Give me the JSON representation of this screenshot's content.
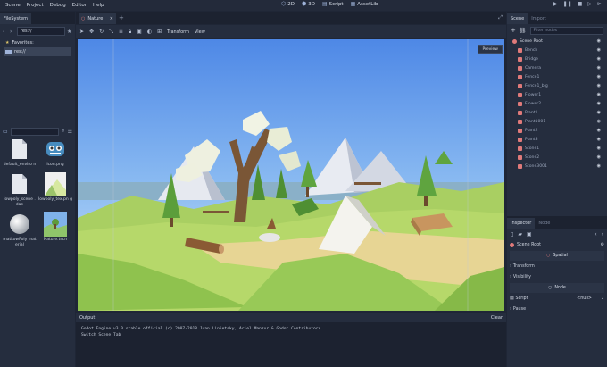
{
  "menu": [
    "Scene",
    "Project",
    "Debug",
    "Editor",
    "Help"
  ],
  "workspace_tabs": [
    {
      "label": "2D",
      "icon": "2d-icon"
    },
    {
      "label": "3D",
      "icon": "3d-icon"
    },
    {
      "label": "Script",
      "icon": "script-icon"
    },
    {
      "label": "AssetLib",
      "icon": "assetlib-icon"
    }
  ],
  "filesystem": {
    "tab": "FileSystem",
    "path": "res://",
    "tree": [
      "Favorites:",
      "res://"
    ],
    "files": [
      {
        "name": "default_enviro n",
        "thumb": "file"
      },
      {
        "name": "icon.png",
        "thumb": "godot"
      },
      {
        "name": "lowpoly_scene .dae",
        "thumb": "file"
      },
      {
        "name": "lowpoly_tex.pn g",
        "thumb": "texture"
      },
      {
        "name": "matLowPoly material",
        "thumb": "sphere"
      },
      {
        "name": "Nature.tscn",
        "thumb": "scene"
      }
    ]
  },
  "editor": {
    "scene_tab": "Nature",
    "toolbar_labels": [
      "Transform",
      "View"
    ],
    "preview": "Preview"
  },
  "output": {
    "title": "Output",
    "clear": "Clear",
    "lines": [
      "Godot Engine v3.0.stable.official (c) 2007-2018 Juan Linietsky, Ariel Manzur & Godot Contributors.",
      "Switch Scene Tab"
    ]
  },
  "scene_panel": {
    "tabs": [
      "Scene",
      "Import"
    ],
    "filter_placeholder": "Filter nodes",
    "root": "Scene Root",
    "nodes": [
      "Bench",
      "Bridge",
      "Camera",
      "Fence1",
      "Fence1_big",
      "Flower1",
      "Flower2",
      "Plant1",
      "Plant1001",
      "Plant2",
      "Plant3",
      "Stone1",
      "Stone2",
      "Stone3001"
    ]
  },
  "inspector": {
    "tabs": [
      "Inspector",
      "Node"
    ],
    "object": "Scene Root",
    "spatial_label": "Spatial",
    "sections": [
      "Transform",
      "Visibility"
    ],
    "node_label": "Node",
    "script_label": "Script",
    "script_value": "<null>",
    "pause_label": "Pause"
  },
  "colors": {
    "accent": "#5b8fe0",
    "bg": "#1f2636",
    "panel": "#252d3e"
  }
}
